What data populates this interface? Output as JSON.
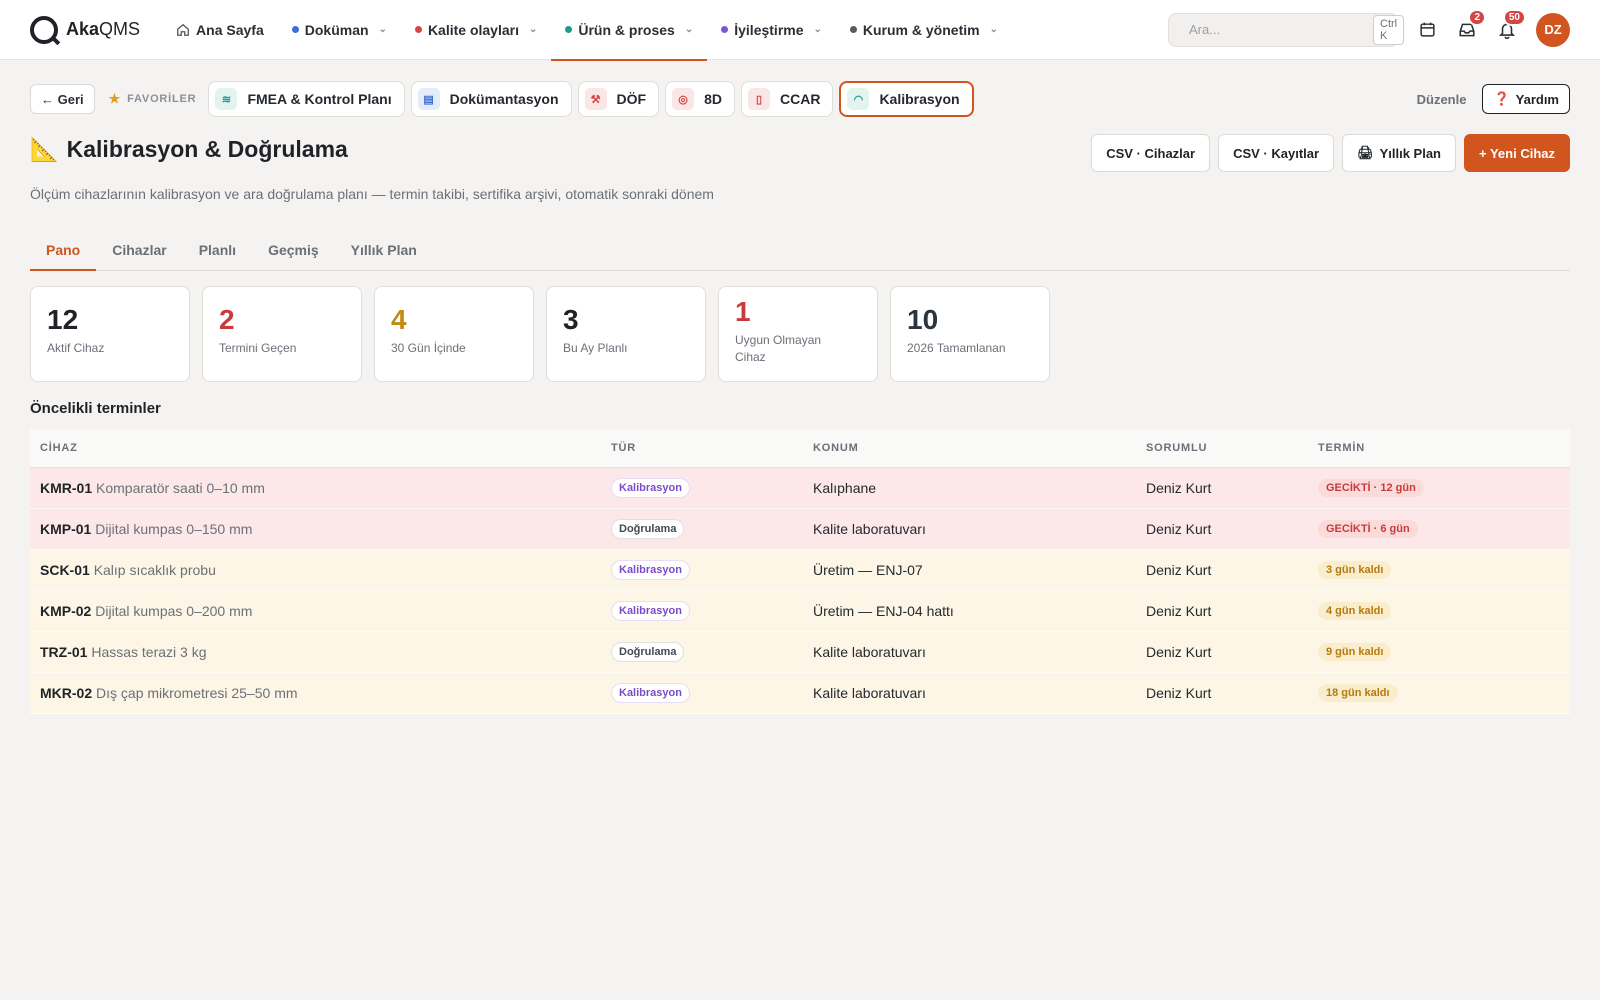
{
  "app": {
    "logo_bold": "Aka",
    "logo_rest": "QMS"
  },
  "nav": {
    "home": "Ana Sayfa",
    "items": [
      {
        "label": "Doküman",
        "color": "#3b6fd4"
      },
      {
        "label": "Kalite olayları",
        "color": "#d64545"
      },
      {
        "label": "Ürün & proses",
        "color": "#1a9c8a"
      },
      {
        "label": "İyileştirme",
        "color": "#7b55d6"
      },
      {
        "label": "Kurum & yönetim",
        "color": "#555b63"
      }
    ],
    "search_placeholder": "Ara...",
    "search_shortcut": "Ctrl K",
    "inbox_count": "2",
    "notif_count": "50",
    "avatar": "DZ"
  },
  "favbar": {
    "back": "← Geri",
    "favorites_label": "FAVORİLER",
    "chips": [
      {
        "label": "FMEA & Kontrol Planı",
        "icon": "layers-icon"
      },
      {
        "label": "Dokümantasyon",
        "icon": "doc-icon"
      },
      {
        "label": "DÖF",
        "icon": "wrench-icon"
      },
      {
        "label": "8D",
        "icon": "target-icon"
      },
      {
        "label": "CCAR",
        "icon": "clipboard-icon"
      },
      {
        "label": "Kalibrasyon",
        "icon": "gauge-icon"
      }
    ],
    "edit": "Düzenle",
    "help": "Yardım"
  },
  "header": {
    "title": "Kalibrasyon & Doğrulama",
    "subtitle": "Ölçüm cihazlarının kalibrasyon ve ara doğrulama planı — termin takibi, sertifika arşivi, otomatik sonraki dönem",
    "actions": {
      "csv_devices": "CSV · Cihazlar",
      "csv_records": "CSV · Kayıtlar",
      "yearly_plan": "Yıllık Plan",
      "new_device": "+ Yeni Cihaz"
    }
  },
  "tabs": [
    "Pano",
    "Cihazlar",
    "Planlı",
    "Geçmiş",
    "Yıllık Plan"
  ],
  "stats": [
    {
      "value": "12",
      "label": "Aktif Cihaz",
      "color": "#1f2328"
    },
    {
      "value": "2",
      "label": "Termini Geçen",
      "color": "#c93b3b"
    },
    {
      "value": "4",
      "label": "30 Gün İçinde",
      "color": "#c48a12"
    },
    {
      "value": "3",
      "label": "Bu Ay Planlı",
      "color": "#1f2328"
    },
    {
      "value": "1",
      "label": "Uygun Olmayan Cihaz",
      "color": "#c93b3b"
    },
    {
      "value": "10",
      "label": "2026 Tamamlanan",
      "color": "#2c3440"
    }
  ],
  "section_title": "Öncelikli terminler",
  "table": {
    "headers": [
      "CİHAZ",
      "TÜR",
      "KONUM",
      "SORUMLU",
      "TERMİN"
    ],
    "rows": [
      {
        "code": "KMR-01",
        "name": "Komparatör saati 0–10 mm",
        "type": "Kalibrasyon",
        "location": "Kalıphane",
        "owner": "Deniz Kurt",
        "due": "GECİKTİ · 12 gün",
        "status": "late"
      },
      {
        "code": "KMP-01",
        "name": "Dijital kumpas 0–150 mm",
        "type": "Doğrulama",
        "location": "Kalite laboratuvarı",
        "owner": "Deniz Kurt",
        "due": "GECİKTİ · 6 gün",
        "status": "late"
      },
      {
        "code": "SCK-01",
        "name": "Kalıp sıcaklık probu",
        "type": "Kalibrasyon",
        "location": "Üretim — ENJ-07",
        "owner": "Deniz Kurt",
        "due": "3 gün kaldı",
        "status": "soon"
      },
      {
        "code": "KMP-02",
        "name": "Dijital kumpas 0–200 mm",
        "type": "Kalibrasyon",
        "location": "Üretim — ENJ-04 hattı",
        "owner": "Deniz Kurt",
        "due": "4 gün kaldı",
        "status": "soon"
      },
      {
        "code": "TRZ-01",
        "name": "Hassas terazi 3 kg",
        "type": "Doğrulama",
        "location": "Kalite laboratuvarı",
        "owner": "Deniz Kurt",
        "due": "9 gün kaldı",
        "status": "soon"
      },
      {
        "code": "MKR-02",
        "name": "Dış çap mikrometresi 25–50 mm",
        "type": "Kalibrasyon",
        "location": "Kalite laboratuvarı",
        "owner": "Deniz Kurt",
        "due": "18 gün kaldı",
        "status": "soon"
      }
    ]
  }
}
